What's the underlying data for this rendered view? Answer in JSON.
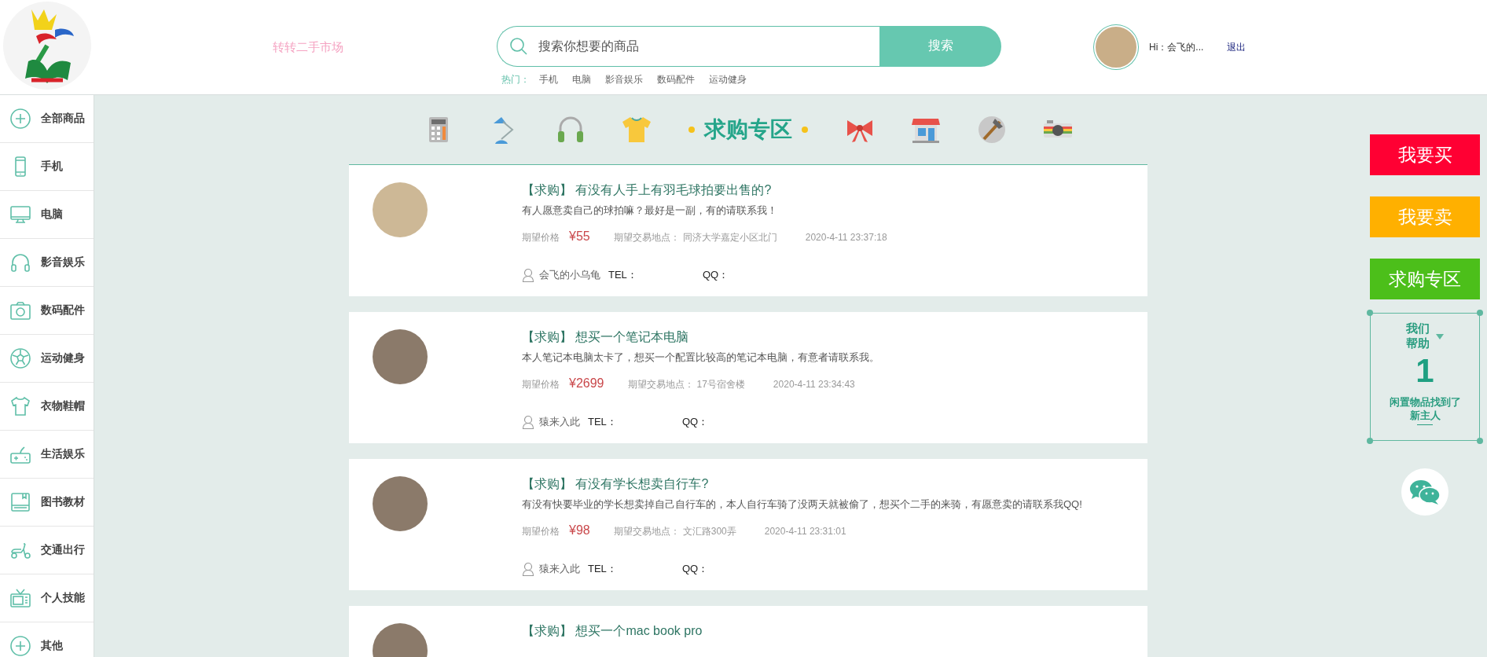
{
  "header": {
    "site_name": "转转二手市场",
    "search": {
      "placeholder": "搜索你想要的商品",
      "button": "搜索"
    },
    "hot_label": "热门：",
    "hot_links": [
      "手机",
      "电脑",
      "影音娱乐",
      "数码配件",
      "运动健身"
    ],
    "greeting": "Hi：会飞的...",
    "logout": "退出"
  },
  "sidebar": {
    "items": [
      {
        "label": "全部商品",
        "kind": "plus"
      },
      {
        "label": "手机",
        "kind": "phone"
      },
      {
        "label": "电脑",
        "kind": "monitor"
      },
      {
        "label": "影音娱乐",
        "kind": "headphones"
      },
      {
        "label": "数码配件",
        "kind": "camera"
      },
      {
        "label": "运动健身",
        "kind": "ball"
      },
      {
        "label": "衣物鞋帽",
        "kind": "shirt"
      },
      {
        "label": "生活娱乐",
        "kind": "gamepad"
      },
      {
        "label": "图书教材",
        "kind": "book"
      },
      {
        "label": "交通出行",
        "kind": "scooter"
      },
      {
        "label": "个人技能",
        "kind": "tv"
      },
      {
        "label": "其他",
        "kind": "plus"
      }
    ]
  },
  "category_bar": {
    "heading": "求购专区"
  },
  "posts": [
    {
      "tag": "【求购】",
      "title": "有没有人手上有羽毛球拍要出售的?",
      "description": "有人愿意卖自己的球拍嘛？最好是一副，有的请联系我！",
      "price_label": "期望价格",
      "price": "¥55",
      "place_label": "期望交易地点：",
      "place": "同济大学嘉定小区北门",
      "time": "2020-4-11 23:37:18",
      "user": "会飞的小乌龟",
      "tel_label": "TEL：",
      "qq_label": "QQ："
    },
    {
      "tag": "【求购】",
      "title": "想买一个笔记本电脑",
      "description": "本人笔记本电脑太卡了，想买一个配置比较高的笔记本电脑，有意者请联系我。",
      "price_label": "期望价格",
      "price": "¥2699",
      "place_label": "期望交易地点：",
      "place": "17号宿舍楼",
      "time": "2020-4-11 23:34:43",
      "user": "猿来入此",
      "tel_label": "TEL：",
      "qq_label": "QQ："
    },
    {
      "tag": "【求购】",
      "title": "有没有学长想卖自行车?",
      "description": "有没有快要毕业的学长想卖掉自己自行车的，本人自行车骑了没两天就被偷了，想买个二手的来骑，有愿意卖的请联系我QQ!",
      "price_label": "期望价格",
      "price": "¥98",
      "place_label": "期望交易地点：",
      "place": "文汇路300弄",
      "time": "2020-4-11 23:31:01",
      "user": "猿来入此",
      "tel_label": "TEL：",
      "qq_label": "QQ："
    },
    {
      "tag": "【求购】",
      "title": "想买一个mac book pro"
    }
  ],
  "side_buttons": [
    {
      "label": "我要买",
      "color": "#ff0033"
    },
    {
      "label": "我要卖",
      "color": "#ffb000"
    },
    {
      "label": "求购专区",
      "color": "#4cbf1a"
    }
  ],
  "help_box": {
    "title": "我们帮助",
    "count": "1",
    "caption": "闲置物品找到了新主人"
  }
}
